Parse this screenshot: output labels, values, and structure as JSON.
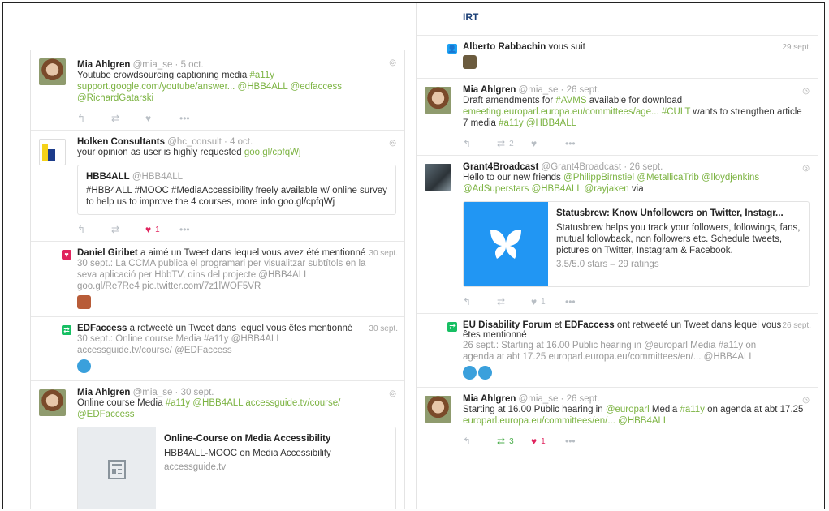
{
  "colors": {
    "link": "#7cb342",
    "like": "#e0245e",
    "retweet": "#4cae4c",
    "follow_badge": "#1da1f2",
    "like_badge": "#e0245e",
    "rt_badge": "#17bf63"
  },
  "left": {
    "t1": {
      "name": "Mia Ahlgren",
      "handle": "@mia_se",
      "time": "· 5 oct.",
      "text": "Youtube crowdsourcing captioning media",
      "tag": "#a11y",
      "link": "support.google.com/youtube/answer...",
      "m1": "@HBB4ALL",
      "m2": "@edfaccess",
      "m3": "@RichardGatarski"
    },
    "t2": {
      "name": "Holken Consultants",
      "handle": "@hc_consult",
      "time": "· 4 oct.",
      "text": "your opinion as user is highly requested",
      "link": "goo.gl/cpfqWj",
      "quote_name": "HBB4ALL",
      "quote_handle": "@HBB4ALL",
      "quote_text": "#HBB4ALL #MOOC #MediaAccessibility freely available w/ online survey to help us to improve the 4 courses, more info goo.gl/cpfqWj",
      "likes": "1"
    },
    "n1": {
      "who": "Daniel Giribet",
      "action": "a aimé un Tweet dans lequel vous avez été mentionné",
      "time": "30 sept.",
      "detail": "30 sept.: La CCMA publica el programari per visualitzar subtítols en la seva aplicació per HbbTV, dins del projecte @HBB4ALL goo.gl/Re7Re4 pic.twitter.com/7z1lWOF5VR"
    },
    "n2": {
      "who": "EDFaccess",
      "action": "a retweeté un Tweet dans lequel vous êtes mentionné",
      "time": "30 sept.",
      "detail": "30 sept.: Online course Media #a11y @HBB4ALL accessguide.tv/course/ @EDFaccess"
    },
    "t3": {
      "name": "Mia Ahlgren",
      "handle": "@mia_se",
      "time": "· 30 sept.",
      "text": "Online course Media",
      "tag": "#a11y",
      "m1": "@HBB4ALL",
      "link": "accessguide.tv/course/",
      "m2": "@EDFaccess",
      "card_title": "Online-Course on Media Accessibility",
      "card_desc": "HBB4ALL-MOOC on Media Accessibility",
      "card_site": "accessguide.tv"
    }
  },
  "right": {
    "top_text": "IRT",
    "n1": {
      "who": "Alberto Rabbachin",
      "action": "vous suit",
      "time": "29 sept."
    },
    "t1": {
      "name": "Mia Ahlgren",
      "handle": "@mia_se",
      "time": "· 26 sept.",
      "text1": "Draft amendments for",
      "tag1": "#AVMS",
      "text2": "available for download",
      "link": "emeeting.europarl.europa.eu/committees/age...",
      "tag2": "#CULT",
      "text3": "wants to strengthen article 7 media",
      "tag3": "#a11y",
      "m1": "@HBB4ALL",
      "retweets": "2"
    },
    "t2": {
      "name": "Grant4Broadcast",
      "handle": "@Grant4Broadcast",
      "time": "· 26 sept.",
      "text1": "Hello to our new friends",
      "m1": "@PhilippBirnstiel",
      "m2": "@MetallicaTrib",
      "m3": "@lloydjenkins",
      "m4": "@AdSuperstars",
      "m5": "@HBB4ALL",
      "m6": "@rayjaken",
      "text2": "via",
      "card_title": "Statusbrew: Know Unfollowers on Twitter, Instagr...",
      "card_desc": "Statusbrew helps you track your followers, followings, fans, mutual followback, non followers etc. Schedule tweets, pictures on Twitter, Instagram & Facebook.",
      "card_rating": "3.5/5.0 stars – 29 ratings",
      "likes": "1"
    },
    "n2": {
      "who1": "EU Disability Forum",
      "et": "et",
      "who2": "EDFaccess",
      "action": "ont retweeté un Tweet dans lequel vous êtes mentionné",
      "time": "26 sept.",
      "detail": "26 sept.: Starting at 16.00 Public hearing in @europarl Media #a11y on agenda at abt 17.25 europarl.europa.eu/committees/en/... @HBB4ALL"
    },
    "t3": {
      "name": "Mia Ahlgren",
      "handle": "@mia_se",
      "time": "· 26 sept.",
      "text1": "Starting at 16.00 Public hearing in",
      "m1": "@europarl",
      "text2": "Media",
      "tag": "#a11y",
      "text3": "on agenda at abt 17.25",
      "link": "europarl.europa.eu/committees/en/...",
      "m2": "@HBB4ALL",
      "retweets": "3",
      "likes": "1"
    }
  },
  "icons": {
    "reply": "reply-icon",
    "retweet": "retweet-icon",
    "like": "heart-icon",
    "more": "more-icon",
    "caret": "caret-icon"
  }
}
